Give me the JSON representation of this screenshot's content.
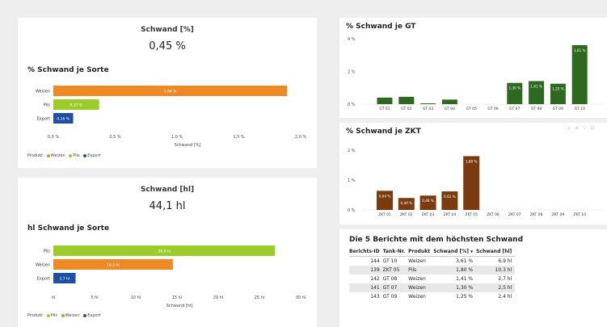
{
  "colors": {
    "weizen": "#ee8a25",
    "pils": "#9ccc2a",
    "export": "#1f4fa3",
    "gt": "#2d6a1f",
    "zkt": "#7a3b10"
  },
  "kpi_pct": {
    "title": "Schwand [%]",
    "value": "0,45 %"
  },
  "kpi_hl": {
    "title": "Schwand [hl]",
    "value": "44,1 hl"
  },
  "legend": {
    "title": "Produkt",
    "items": [
      "Weizen",
      "Pils",
      "Export"
    ],
    "items_hl": [
      "Pils",
      "Weizen",
      "Export"
    ]
  },
  "gt_icons": "◇ ⊘ ▽ ⊡ ···",
  "chart_data": [
    {
      "type": "bar",
      "orientation": "horizontal",
      "title": "% Schwand je Sorte",
      "categories": [
        "Weizen",
        "Pils",
        "Export"
      ],
      "values": [
        1.89,
        0.37,
        0.16
      ],
      "labels": [
        "1,89 %",
        "0,37 %",
        "0,16 %"
      ],
      "xticks": [
        "0,0 %",
        "0,5 %",
        "1,0 %",
        "1,5 %",
        "2,0 %"
      ],
      "xlim": [
        0,
        2
      ],
      "xlabel": "Schwand [%]"
    },
    {
      "type": "bar",
      "orientation": "horizontal",
      "title": "hl Schwand je Sorte",
      "categories": [
        "Pils",
        "Weizen",
        "Export"
      ],
      "values": [
        26.9,
        14.5,
        2.7
      ],
      "labels": [
        "26,9 hl",
        "14,5 hl",
        "2,7 hl"
      ],
      "xticks": [
        "hl",
        "5 hl",
        "10 hl",
        "15 hl",
        "20 hl",
        "25 hl",
        "30 hl"
      ],
      "xlim": [
        0,
        30
      ],
      "xlabel": "Schwand [hl]"
    },
    {
      "type": "bar",
      "title": "% Schwand je GT",
      "categories": [
        "GT 01",
        "GT 02",
        "GT 03",
        "GT 04",
        "GT 05",
        "GT 06",
        "GT 07",
        "GT 08",
        "GT 09",
        "GT 10"
      ],
      "values": [
        0.4,
        0.45,
        0.05,
        0.28,
        0,
        0,
        1.3,
        1.41,
        1.25,
        3.61
      ],
      "labels": [
        "",
        "",
        "",
        "",
        "",
        "",
        "1,30 %",
        "1,41 %",
        "1,25 %",
        "3,61 %"
      ],
      "yticks": [
        "4 %",
        "2 %",
        "0 %"
      ],
      "ylim": [
        0,
        4
      ]
    },
    {
      "type": "bar",
      "title": "% Schwand je ZKT",
      "categories": [
        "ZKT 01",
        "ZKT 02",
        "ZKT 03",
        "ZKT 04",
        "ZKT 05",
        "ZKT 06",
        "ZKT 07",
        "ZKT 08",
        "ZKT 09",
        "ZKT 10"
      ],
      "values": [
        0.64,
        0.4,
        0.48,
        0.62,
        1.8,
        0,
        0,
        0,
        0,
        0
      ],
      "labels": [
        "0,64 %",
        "0,40 %",
        "0,48 %",
        "0,62 %",
        "1,80 %",
        "",
        "",
        "",
        "",
        ""
      ],
      "yticks": [
        "2 %",
        "1 %",
        "0 %"
      ],
      "ylim": [
        0,
        2
      ]
    },
    {
      "type": "table",
      "title": "Die 5 Berichte mit dem höchsten Schwand",
      "columns": [
        "Berichts-ID",
        "Tank-Nr.",
        "Produkt",
        "Schwand [%]",
        "Schwand [hl]"
      ],
      "rows": [
        [
          "144",
          "GT 10",
          "Weizen",
          "3,61 %",
          "6,9 hl"
        ],
        [
          "139",
          "ZKT 05",
          "Pils",
          "1,80 %",
          "10,3 hl"
        ],
        [
          "142",
          "GT 08",
          "Weizen",
          "1,41 %",
          "2,7 hl"
        ],
        [
          "141",
          "GT 07",
          "Weizen",
          "1,30 %",
          "2,5 hl"
        ],
        [
          "143",
          "GT 09",
          "Weizen",
          "1,25 %",
          "2,4 hl"
        ]
      ]
    }
  ]
}
